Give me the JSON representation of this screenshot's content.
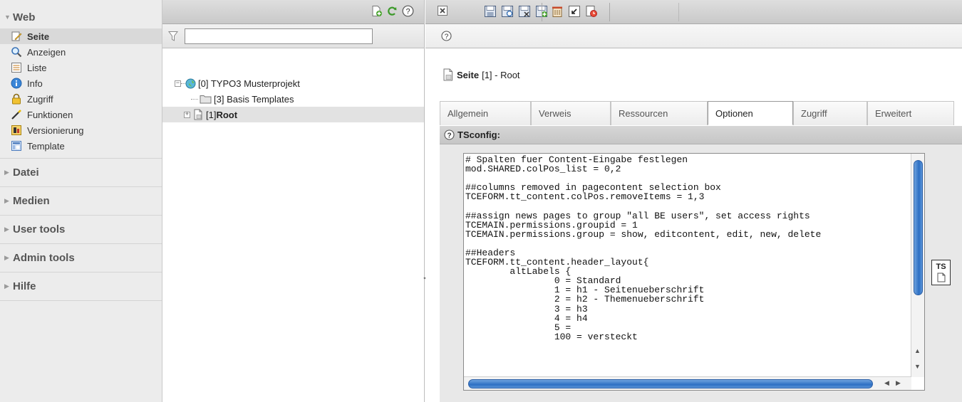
{
  "module_menu": {
    "sections": [
      {
        "label": "Web",
        "open": true
      },
      {
        "label": "Datei",
        "open": false
      },
      {
        "label": "Medien",
        "open": false
      },
      {
        "label": "User tools",
        "open": false
      },
      {
        "label": "Admin tools",
        "open": false
      },
      {
        "label": "Hilfe",
        "open": false
      }
    ],
    "web_items": [
      {
        "label": "Seite",
        "icon": "page-edit-icon",
        "active": true
      },
      {
        "label": "Anzeigen",
        "icon": "magnifier-icon"
      },
      {
        "label": "Liste",
        "icon": "list-icon"
      },
      {
        "label": "Info",
        "icon": "info-icon"
      },
      {
        "label": "Zugriff",
        "icon": "lock-icon"
      },
      {
        "label": "Funktionen",
        "icon": "wand-icon"
      },
      {
        "label": "Versionierung",
        "icon": "versioning-icon"
      },
      {
        "label": "Template",
        "icon": "template-icon"
      }
    ]
  },
  "page_tree": {
    "filter": {
      "value": "",
      "placeholder": ""
    },
    "nodes": [
      {
        "label": "[0] TYPO3 Musterprojekt",
        "bold": false
      },
      {
        "label": "[3] Basis Templates",
        "bold": false
      },
      {
        "label": "[1] ",
        "bold_part": "Root",
        "selected": true
      }
    ]
  },
  "content": {
    "page_header": {
      "bold": "Seite",
      "rest": "[1] - Root"
    },
    "tabs": [
      {
        "label": "Allgemein"
      },
      {
        "label": "Verweis"
      },
      {
        "label": "Ressourcen"
      },
      {
        "label": "Optionen",
        "active": true
      },
      {
        "label": "Zugriff"
      },
      {
        "label": "Erweitert"
      }
    ],
    "section_title": "TSconfig:",
    "tsconfig_lines": [
      "# Spalten fuer Content-Eingabe festlegen",
      "mod.SHARED.colPos_list = 0,2",
      "",
      "##columns removed in pagecontent selection box",
      "TCEFORM.tt_content.colPos.removeItems = 1,3",
      "",
      "##assign news pages to group \"all BE users\", set access rights",
      "TCEMAIN.permissions.groupid = 1",
      "TCEMAIN.permissions.group = show, editcontent, edit, new, delete",
      "",
      "##Headers",
      "TCEFORM.tt_content.header_layout{",
      "        altLabels {",
      "                0 = Standard",
      "                1 = h1 - Seitenueberschrift",
      "                2 = h2 - Themenueberschrift",
      "                3 = h3",
      "                4 = h4",
      "                5 =",
      "                100 = versteckt"
    ],
    "ts_button_label": "TS"
  }
}
